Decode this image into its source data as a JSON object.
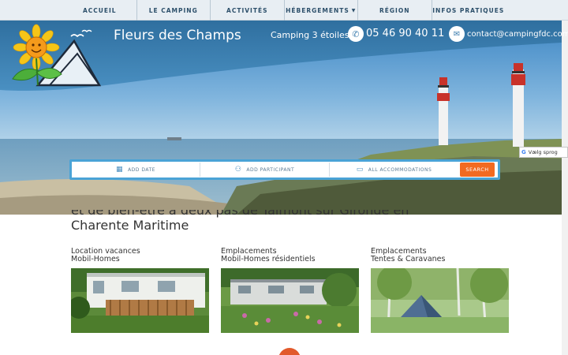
{
  "nav": {
    "items": [
      "ACCUEIL",
      "LE CAMPING",
      "ACTIVITÉS",
      "HÉBERGEMENTS",
      "RÉGION",
      "INFOS PRATIQUES"
    ]
  },
  "header": {
    "brand": "Fleurs des Champs",
    "rating": "Camping 3 étoiles",
    "phone": "05 46 90 40 11",
    "email": "contact@campingfdc.com",
    "phone_icon": "phone-icon",
    "mail_icon": "mail-icon"
  },
  "search": {
    "date_label": "ADD DATE",
    "participant_label": "ADD PARTICIPANT",
    "accommodation_label": "ALL ACCOMMODATIONS",
    "button_label": "SEARCH"
  },
  "translate": {
    "label": "Vælg sprog",
    "icon": "G"
  },
  "intro": {
    "line1": "et de bien-être à deux pas de Talmont sur Gironde en",
    "line2": "Charente Maritime"
  },
  "cards": [
    {
      "title": "Location vacances",
      "subtitle": "Mobil-Homes"
    },
    {
      "title": "Emplacements",
      "subtitle": "Mobil-Homes résidentiels"
    },
    {
      "title": "Emplacements",
      "subtitle": "Tentes & Caravanes"
    }
  ],
  "colors": {
    "header_blue": "#3f7fb0",
    "accent_orange": "#f26a21",
    "search_border": "#4aa3d6"
  }
}
